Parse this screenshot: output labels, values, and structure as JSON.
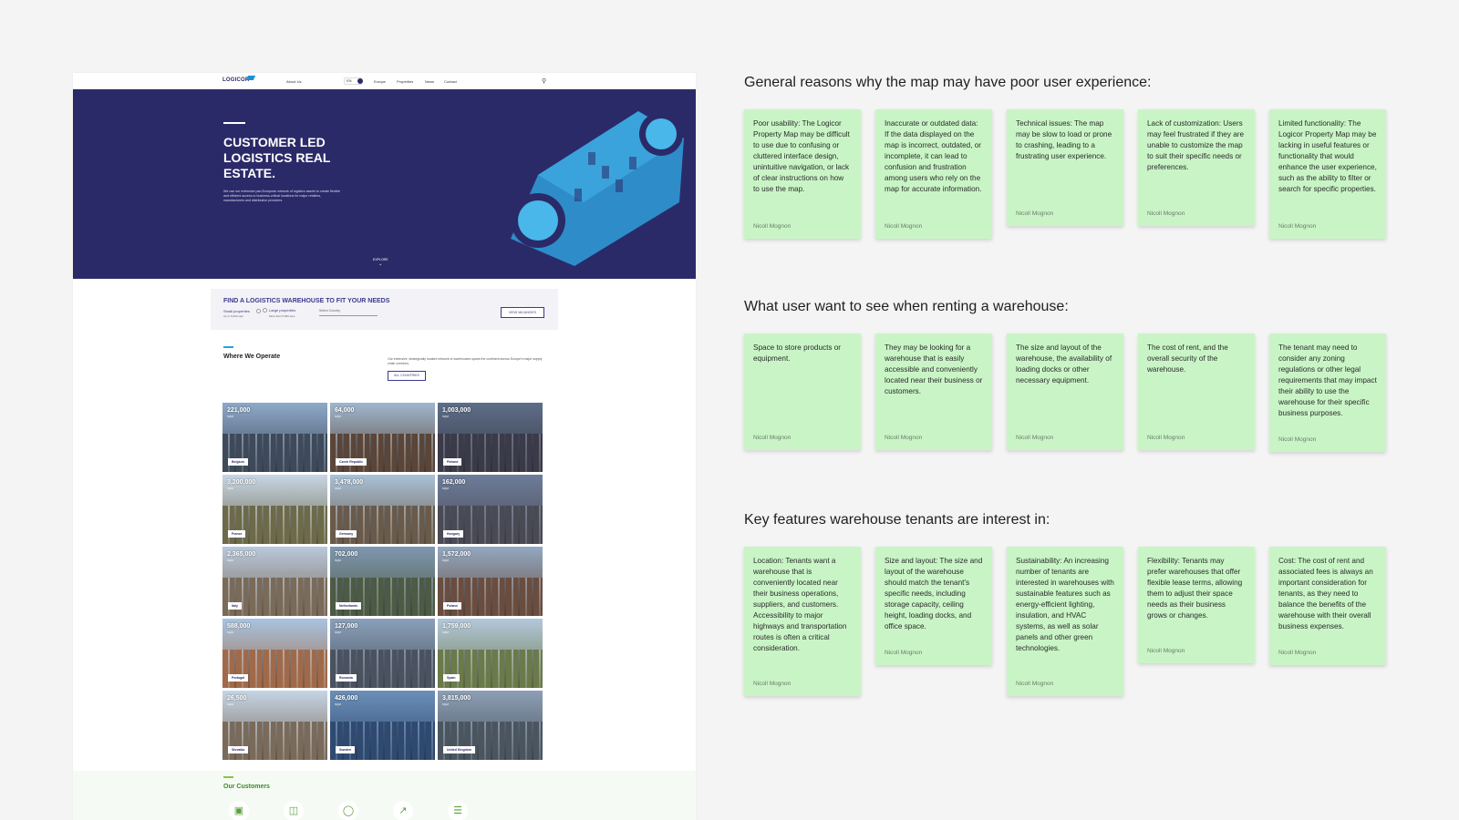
{
  "website": {
    "nav": {
      "logo": "LOGICOR",
      "about": "About Us",
      "lang": "EN",
      "links": [
        "Europe",
        "Properties",
        "News",
        "Contact"
      ]
    },
    "hero": {
      "title": "CUSTOMER LED LOGISTICS REAL ESTATE.",
      "text": "We use our extensive pan-European network of logistics assets to create flexible and efficient access to business-critical locations for major retailers, manufacturers and distribution providers.",
      "explore": "EXPLORE"
    },
    "finder": {
      "title": "FIND A LOGISTICS WAREHOUSE TO FIT YOUR NEEDS",
      "small_label": "Small properties",
      "small_sub": "Up to 5,000 sqm",
      "large_label": "Large properties",
      "large_sub": "More than 5,000 sqm",
      "select_placeholder": "Select Country",
      "button": "VIEW VACANCIES"
    },
    "operate": {
      "title": "Where We Operate",
      "text": "Our extensive, strategically located network of warehouses spans the continent across Europe's major supply chain corridors.",
      "button": "ALL COUNTRIES"
    },
    "countries": [
      {
        "value": "221,000",
        "unit": "SQM",
        "name": "Belgium"
      },
      {
        "value": "64,000",
        "unit": "SQM",
        "name": "Czech Republic"
      },
      {
        "value": "1,003,000",
        "unit": "SQM",
        "name": "Finland"
      },
      {
        "value": "3,200,000",
        "unit": "SQM",
        "name": "France"
      },
      {
        "value": "3,478,000",
        "unit": "SQM",
        "name": "Germany"
      },
      {
        "value": "162,000",
        "unit": "SQM",
        "name": "Hungary"
      },
      {
        "value": "2,365,000",
        "unit": "SQM",
        "name": "Italy"
      },
      {
        "value": "702,000",
        "unit": "SQM",
        "name": "Netherlands"
      },
      {
        "value": "1,572,000",
        "unit": "SQM",
        "name": "Poland"
      },
      {
        "value": "588,000",
        "unit": "SQM",
        "name": "Portugal"
      },
      {
        "value": "127,000",
        "unit": "SQM",
        "name": "Romania"
      },
      {
        "value": "1,759,000",
        "unit": "SQM",
        "name": "Spain"
      },
      {
        "value": "26,500",
        "unit": "SQM",
        "name": "Slovakia"
      },
      {
        "value": "426,000",
        "unit": "SQM",
        "name": "Sweden"
      },
      {
        "value": "3,815,000",
        "unit": "SQM",
        "name": "United Kingdom"
      }
    ],
    "customers": {
      "title": "Our Customers",
      "icons": [
        "box-icon",
        "shopping-bag-icon",
        "apple-icon",
        "hammer-icon",
        "car-icon"
      ]
    }
  },
  "board": {
    "sections": [
      {
        "title": "General reasons why the map may have poor user experience:",
        "notes": [
          {
            "text": "Poor usability: The Logicor Property Map may be difficult to use due to confusing or cluttered interface design, unintuitive navigation, or lack of clear instructions on how to use the map.",
            "author": "Nicoll Mognon"
          },
          {
            "text": "Inaccurate or outdated data: If the data displayed on the map is incorrect, outdated, or incomplete, it can lead to confusion and frustration among users who rely on the map for accurate information.",
            "author": "Nicoll Mognon"
          },
          {
            "text": "Technical issues: The map may be slow to load or prone to crashing, leading to a frustrating user experience.",
            "author": "Nicoll Mognon"
          },
          {
            "text": "Lack of customization: Users may feel frustrated if they are unable to customize the map to suit their specific needs or preferences.",
            "author": "Nicoll Mognon"
          },
          {
            "text": "Limited functionality: The Logicor Property Map may be lacking in useful features or functionality that would enhance the user experience, such as the ability to filter or search for specific properties.",
            "author": "Nicoll Mognon"
          }
        ]
      },
      {
        "title": "What user want to see when renting a warehouse:",
        "notes": [
          {
            "text": "Space to store products or equipment.",
            "author": "Nicoll Mognon"
          },
          {
            "text": "They may be looking for a warehouse that is easily accessible and conveniently located near their business or customers.",
            "author": "Nicoll Mognon"
          },
          {
            "text": "The size and layout of the warehouse, the availability of loading docks or other necessary equipment.",
            "author": "Nicoll Mognon"
          },
          {
            "text": "The cost of rent, and the overall security of the warehouse.",
            "author": "Nicoll Mognon"
          },
          {
            "text": "The tenant may need to consider any zoning regulations or other legal requirements that may impact their ability to use the warehouse for their specific business purposes.",
            "author": "Nicoll Mognon"
          }
        ]
      },
      {
        "title": "Key features warehouse tenants are interest in:",
        "notes": [
          {
            "text": "Location: Tenants want a warehouse that is conveniently located near their business operations, suppliers, and customers. Accessibility to major highways and transportation routes is often a critical consideration.",
            "author": "Nicoll Mognon"
          },
          {
            "text": "Size and layout: The size and layout of the warehouse should match the tenant's specific needs, including storage capacity, ceiling height, loading docks, and office space.",
            "author": "Nicoll Mognon"
          },
          {
            "text": "Sustainability: An increasing number of tenants are interested in warehouses with sustainable features such as energy-efficient lighting, insulation, and HVAC systems, as well as solar panels and other green technologies.",
            "author": "Nicoll Mognon"
          },
          {
            "text": "Flexibility: Tenants may prefer warehouses that offer flexible lease terms, allowing them to adjust their space needs as their business grows or changes.",
            "author": "Nicoll Mognon"
          },
          {
            "text": "Cost: The cost of rent and associated fees is always an important consideration for tenants, as they need to balance the benefits of the warehouse with their overall business expenses.",
            "author": "Nicoll Mognon"
          }
        ]
      }
    ]
  },
  "colors": {
    "hero_bg": "#2b2a69",
    "note_bg": "#c9f5c6",
    "accent": "#22a6d9"
  }
}
